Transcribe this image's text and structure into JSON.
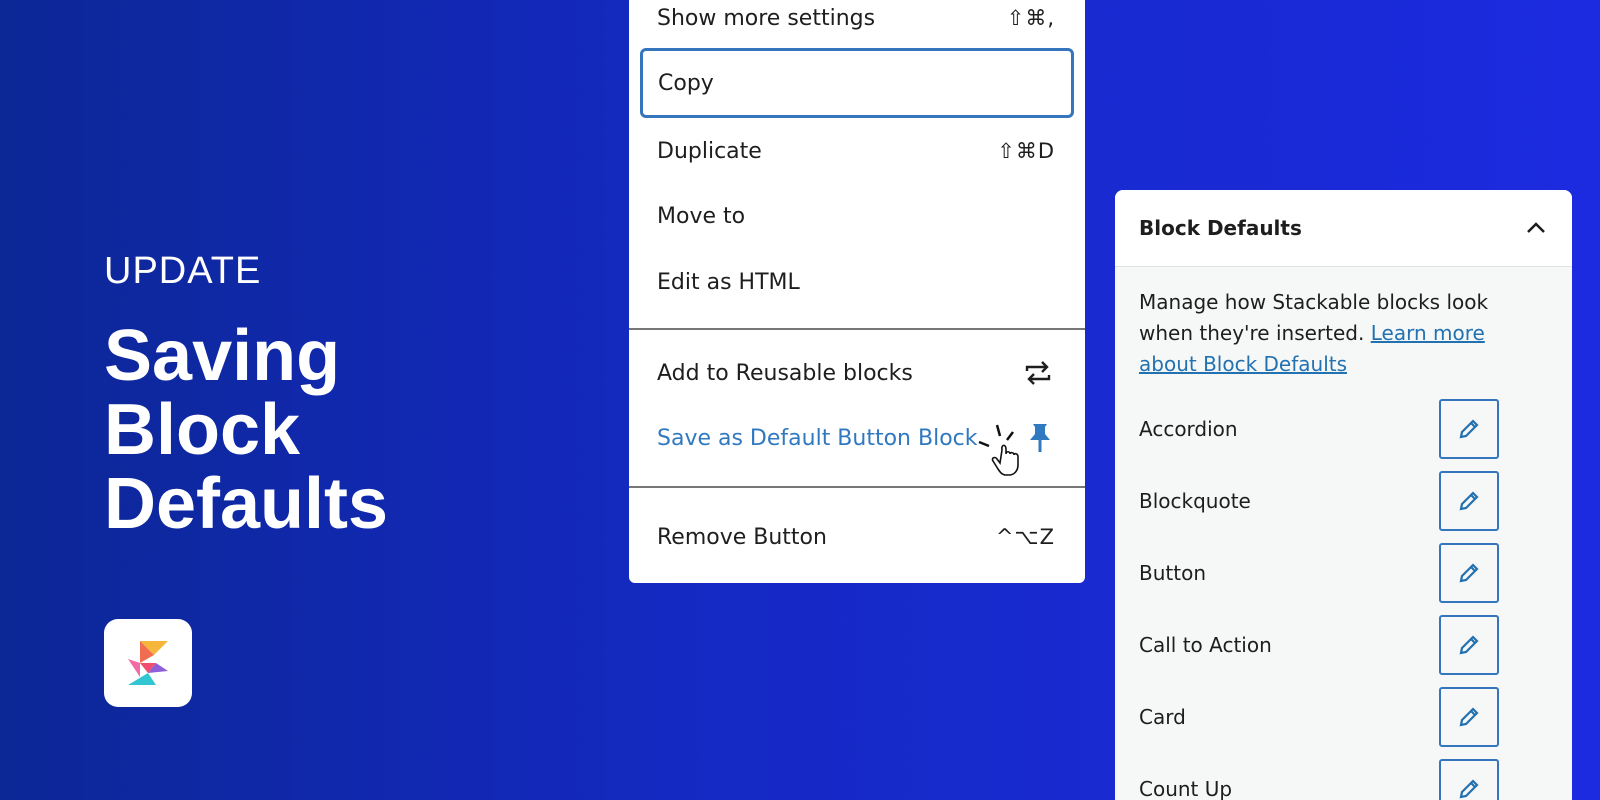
{
  "hero": {
    "eyebrow": "UPDATE",
    "title": "Saving Block Defaults"
  },
  "menu": {
    "items": [
      {
        "label": "Show more settings",
        "shortcut": "⇧⌘,"
      },
      {
        "label": "Copy",
        "shortcut": ""
      },
      {
        "label": "Duplicate",
        "shortcut": "⇧⌘D"
      },
      {
        "label": "Move to",
        "shortcut": ""
      },
      {
        "label": "Edit as HTML",
        "shortcut": ""
      },
      {
        "label": "Add to Reusable blocks",
        "icon": "reusable-block-icon"
      },
      {
        "label": "Save as Default Button Block",
        "icon": "pin-icon"
      },
      {
        "label": "Remove Button",
        "shortcut": "^⌥Z"
      }
    ]
  },
  "panel": {
    "title": "Block Defaults",
    "description": "Manage how Stackable blocks look when they're inserted. ",
    "link": "Learn more about Block Defaults",
    "blocks": [
      {
        "label": "Accordion"
      },
      {
        "label": "Blockquote"
      },
      {
        "label": "Button"
      },
      {
        "label": "Call to Action"
      },
      {
        "label": "Card"
      },
      {
        "label": "Count Up"
      }
    ]
  },
  "colors": {
    "accent": "#3079c1",
    "background": "#1529c4"
  }
}
